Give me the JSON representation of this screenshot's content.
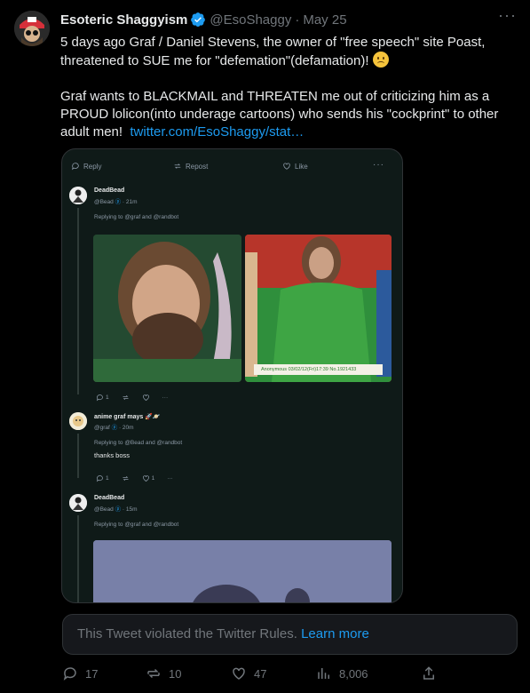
{
  "author": {
    "display_name": "Esoteric Shaggyism",
    "handle": "@EsoShaggy",
    "separator": "·",
    "date": "May 25"
  },
  "tweet": {
    "paragraph1": "5 days ago Graf / Daniel Stevens, the owner of \"free speech\" site Poast, threatened to SUE me for \"defemation\"(defamation)!",
    "paragraph2": "Graf wants to BLACKMAIL and THREATEN me out of criticizing him as a PROUD lolicon(into underage cartoons) who sends his \"cockprint\" to other adult men!",
    "link": "twitter.com/EsoShaggy/stat…"
  },
  "screenshot": {
    "top_actions": {
      "reply": "Reply",
      "repost": "Repost",
      "like": "Like"
    },
    "posts": [
      {
        "name": "DeadBead",
        "handle": "@Bead",
        "time": "· 21m",
        "replying": "Replying to @graf and @randbot",
        "reply_count": "1",
        "caption": "Anonymous 03/02/12(Fri)17:39 No.1921433"
      },
      {
        "name": "anime graf mays 🚀🪐",
        "handle": "@graf",
        "time": "· 20m",
        "replying": "Replying to @Bead and @randbot",
        "body": "thanks boss",
        "reply_count": "1",
        "like_count": "1"
      },
      {
        "name": "DeadBead",
        "handle": "@Bead",
        "time": "· 15m",
        "replying": "Replying to @graf and @randbot"
      }
    ]
  },
  "violation": {
    "text": "This Tweet violated the Twitter Rules.",
    "link": "Learn more"
  },
  "actions": {
    "replies": "17",
    "reposts": "10",
    "likes": "47",
    "views": "8,006"
  },
  "colors": {
    "background": "#000000",
    "link": "#1d9bf0",
    "muted": "#71767b",
    "verified": "#1d9bf0"
  }
}
